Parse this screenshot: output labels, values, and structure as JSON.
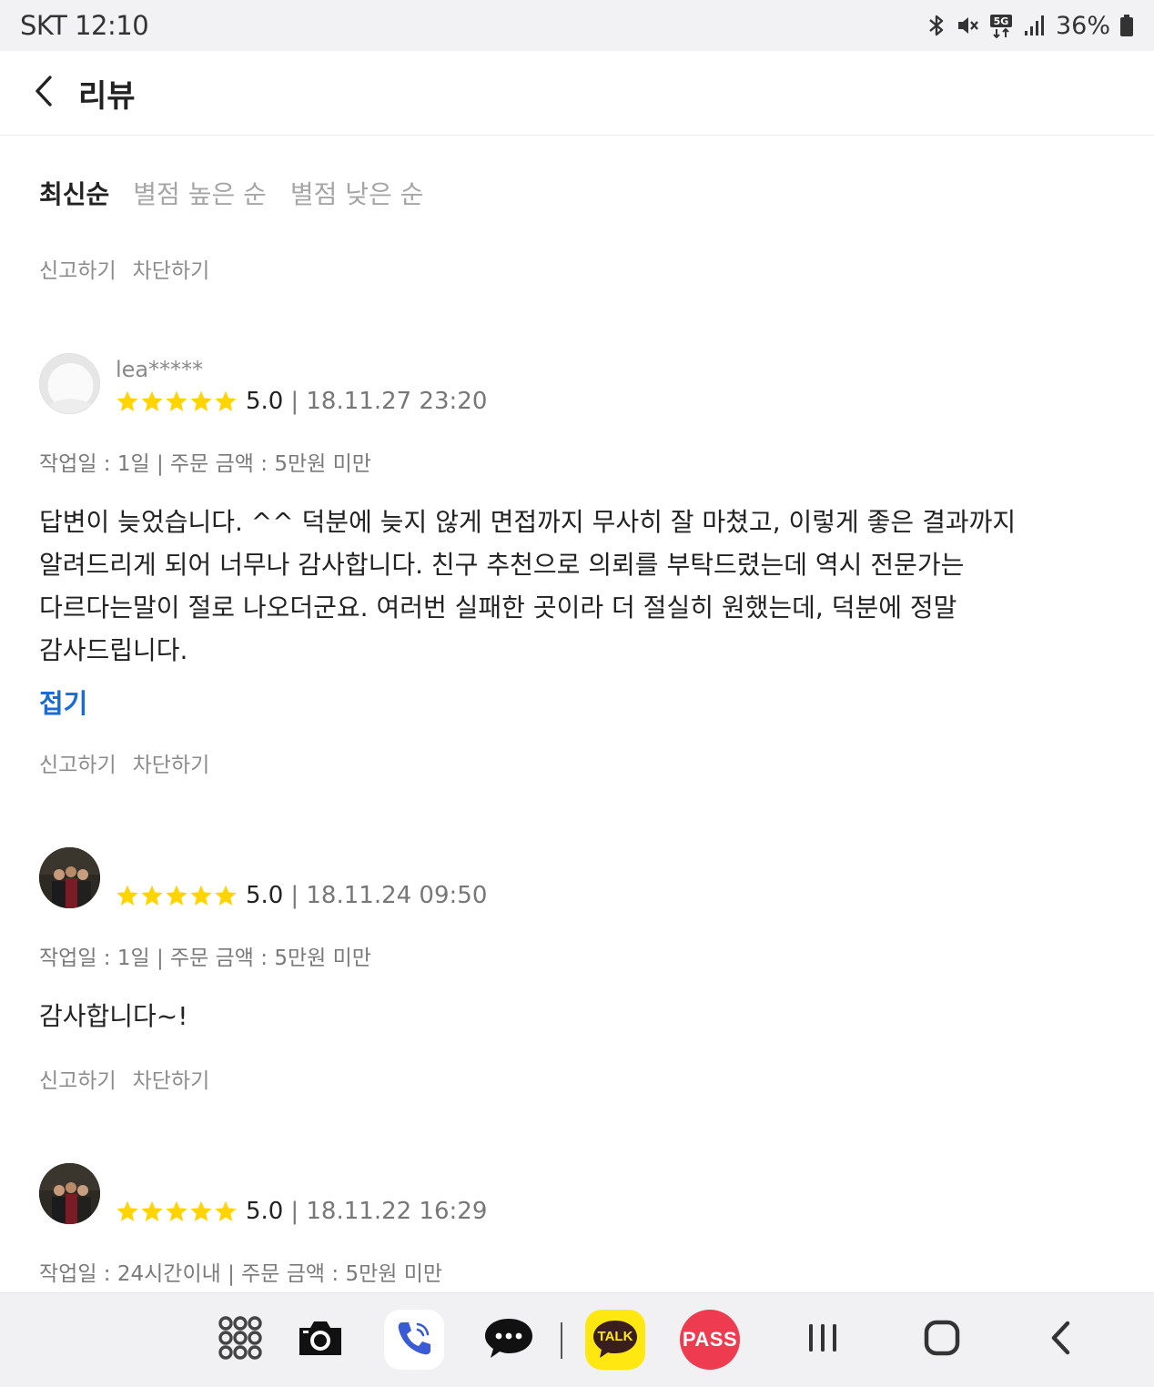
{
  "status_bar": {
    "carrier_time": "SKT 12:10",
    "battery": "36%",
    "icons": [
      "bluetooth-icon",
      "mute-icon",
      "5g-icon",
      "signal-icon",
      "battery-icon"
    ]
  },
  "header": {
    "title": "리뷰",
    "back_icon": "chevron-left-icon"
  },
  "sort_tabs": [
    {
      "label": "최신순",
      "active": true
    },
    {
      "label": "별점 높은 순",
      "active": false
    },
    {
      "label": "별점 낮은 순",
      "active": false
    }
  ],
  "actions": {
    "report": "신고하기",
    "block": "차단하기"
  },
  "reviews": [
    {
      "nickname": "lea*****",
      "score": "5.0",
      "stars": 5,
      "date": "| 18.11.27 23:20",
      "meta": "작업일 : 1일 | 주문 금액 : 5만원 미만",
      "lines": [
        "답변이 늦었습니다. ^^ 덕분에 늦지 않게 면접까지 무사히 잘 마쳤고, 이렇게 좋은 결과까지",
        "알려드리게 되어 너무나 감사합니다. 친구 추천으로 의뢰를 부탁드렸는데 역시 전문가는",
        "다르다는말이 절로 나오더군요. 여러번 실패한 곳이라 더 절실히 원했는데, 덕분에 정말",
        "감사드립니다."
      ],
      "fold": "접기"
    },
    {
      "nickname": "",
      "score": "5.0",
      "stars": 5,
      "date": "| 18.11.24 09:50",
      "meta": "작업일 : 1일 | 주문 금액 : 5만원 미만",
      "lines": [
        "감사합니다~!"
      ]
    },
    {
      "nickname": "",
      "score": "5.0",
      "stars": 5,
      "date": "| 18.11.22 16:29",
      "meta": "작업일 : 24시간이내 | 주문 금액 : 5만원 미만"
    }
  ],
  "nav_bar": {
    "items": [
      "apps-grid-icon",
      "camera-icon",
      "phone-icon",
      "messages-icon",
      "kakaotalk-icon",
      "pass-icon",
      "recents-icon",
      "home-icon",
      "back-icon"
    ],
    "talk_label": "TALK",
    "pass_label": "PASS"
  },
  "colors": {
    "star": "#ffd400",
    "link": "#1a6bd8",
    "kakao": "#ffe812",
    "pass": "#ef3b4f"
  }
}
